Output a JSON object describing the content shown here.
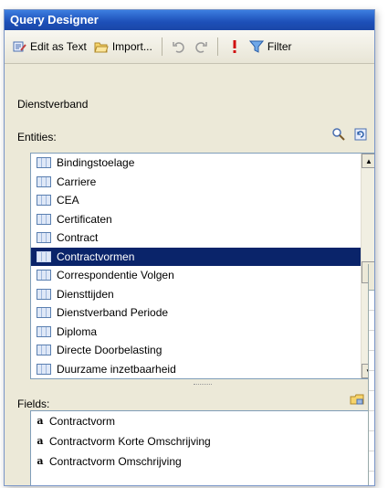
{
  "window": {
    "title": "Query Designer"
  },
  "toolbar": {
    "edit_as_text": "Edit as Text",
    "import": "Import..."
  },
  "filter_label": "Filter",
  "context": "Dienstverband",
  "entities": {
    "label": "Entities:",
    "items": [
      {
        "label": "Bindingstoelage",
        "selected": false
      },
      {
        "label": "Carriere",
        "selected": false
      },
      {
        "label": "CEA",
        "selected": false
      },
      {
        "label": "Certificaten",
        "selected": false
      },
      {
        "label": "Contract",
        "selected": false
      },
      {
        "label": "Contractvormen",
        "selected": true
      },
      {
        "label": "Correspondentie Volgen",
        "selected": false
      },
      {
        "label": "Diensttijden",
        "selected": false
      },
      {
        "label": "Dienstverband Periode",
        "selected": false
      },
      {
        "label": "Diploma",
        "selected": false
      },
      {
        "label": "Directe Doorbelasting",
        "selected": false
      },
      {
        "label": "Duurzame inzetbaarheid",
        "selected": false
      }
    ]
  },
  "fields": {
    "label": "Fields:",
    "items": [
      {
        "type_glyph": "a",
        "label": "Contractvorm"
      },
      {
        "type_glyph": "a",
        "label": "Contractvorm Korte Omschrijving"
      },
      {
        "type_glyph": "a",
        "label": "Contractvorm Omschrijving"
      }
    ]
  },
  "icons": {
    "edit_as_text": "edit-text-icon",
    "import": "folder-open-icon",
    "undo": "undo-icon",
    "redo": "redo-icon",
    "run": "exclamation-icon",
    "filter": "funnel-icon",
    "search": "search-icon",
    "refresh": "refresh-icon",
    "fields_tool": "folder-tool-icon"
  },
  "colors": {
    "selection": "#0a246a",
    "titlebar": "#1d4fb8",
    "panel": "#ece9d8"
  }
}
